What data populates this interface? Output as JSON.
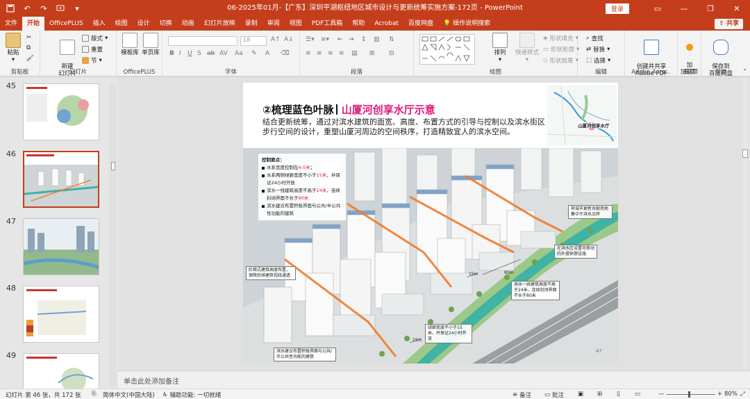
{
  "window": {
    "title": "06-2025年01月-【广东】深圳平湖枢纽地区城市设计与更新统筹实施方案-172页 - PowerPoint",
    "login_label": "登录",
    "share_label": "共享"
  },
  "tabs": [
    "文件",
    "开始",
    "OfficePLUS",
    "插入",
    "绘图",
    "设计",
    "切换",
    "动画",
    "幻灯片放映",
    "录制",
    "审阅",
    "视图",
    "PDF工具箱",
    "帮助",
    "Acrobat",
    "百度网盘",
    "操作说明搜索"
  ],
  "active_tab": "开始",
  "ribbon": {
    "clipboard": {
      "label": "剪贴板",
      "paste": "粘贴"
    },
    "slides": {
      "label": "幻灯片",
      "new_slide": "新建\n幻灯片",
      "layout": "版式",
      "reset": "重置",
      "section": "节"
    },
    "officeplus": {
      "label": "OfficePLUS",
      "template": "模板库",
      "single": "单页库"
    },
    "font": {
      "label": "字体",
      "size": "18"
    },
    "paragraph": {
      "label": "段落"
    },
    "drawing": {
      "label": "绘图",
      "arrange": "排列",
      "quick_styles": "快速样式",
      "fill": "形状填充",
      "outline": "形状轮廓",
      "effects": "形状效果"
    },
    "editing": {
      "label": "编辑",
      "find": "查找",
      "replace": "替换",
      "select": "选择"
    },
    "adobe": {
      "label": "Adobe Acro...",
      "create_share": "创建并共享\nAdobe PDF"
    },
    "addins": {
      "label": "加载项",
      "add": "加\n载项"
    },
    "save": {
      "label": "保存",
      "save_baidu": "保存到\n百度网盘"
    }
  },
  "thumbnails": [
    {
      "num": "45"
    },
    {
      "num": "46"
    },
    {
      "num": "47"
    },
    {
      "num": "48"
    },
    {
      "num": "49"
    }
  ],
  "slide": {
    "title_main": "②梳理蓝色叶脉",
    "title_sub": "山厦河创享水厅示意",
    "body": "结合更新统筹，通过对滨水建筑的面宽、高度、布置方式的引导与控制以及滨水街区步行空间的设计，重塑山厦河周边的空间秩序，打造精致宜人的滨水空间。",
    "map_label": "山厦河创享水厅",
    "key_title": "控制要点：",
    "key_points": [
      {
        "pre": "水系宽度控制在",
        "hl": "4-5米",
        "post": "；"
      },
      {
        "pre": "水系两侧绿廊宽度不小于",
        "hl": "15米",
        "post": "，并保证24小时开放"
      },
      {
        "pre": "滨水一线建筑高度不高于",
        "hl": "24米",
        "post": "，连续封闭界面不长于",
        "hl2": "80米"
      },
      {
        "pre": "滨水建议布置积极界面与公共/半公共性功能的建筑",
        "hl": "",
        "post": ""
      }
    ],
    "callouts": [
      "将城市更新贡献用地集中于滨水沿岸",
      "在滨水区设置可移动的外摆休憩设施",
      "阶梯式建筑高度布置，保障后排建筑视线通透",
      "滨水一线建筑高度不高于24米，连续封闭界面不长于80米",
      "绿廊宽度不小于15米，并保证24小时开放",
      "滨水建议布置积极界面与公共/半公共性功能的建筑"
    ],
    "dims": [
      "80m",
      "15m",
      "15m"
    ],
    "page_number": "47"
  },
  "notes_placeholder": "单击此处添加备注",
  "status": {
    "slide_info": "幻灯片 第 46 张，共 172 张",
    "language": "简体中文(中国大陆)",
    "accessibility": "辅助功能: 一切就绪",
    "notes": "备注",
    "comments": "批注",
    "zoom": "80%"
  },
  "colors": {
    "accent": "#c43e1c",
    "highlight": "#e0197d",
    "route": "#f07a2a"
  }
}
